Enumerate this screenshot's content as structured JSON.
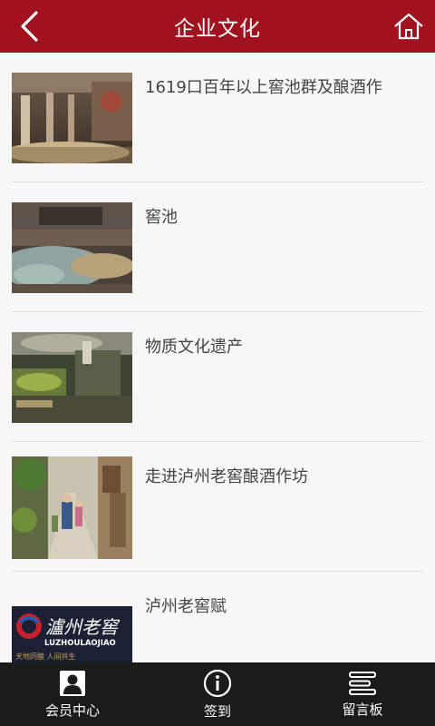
{
  "header": {
    "title": "企业文化",
    "back_icon": "chevron-left-icon",
    "home_icon": "home-icon"
  },
  "colors": {
    "brand": "#a2121e",
    "tabbar": "#1b1b1b"
  },
  "articles": [
    {
      "title": "1619口百年以上窖池群及酿酒作",
      "image": "cellar-pits-photo"
    },
    {
      "title": "窖池",
      "image": "cellar-pit-photo"
    },
    {
      "title": "物质文化遗产",
      "image": "distillery-equipment-photo"
    },
    {
      "title": "走进泸州老窖酿酒作坊",
      "image": "alley-street-photo"
    },
    {
      "title": "泸州老窖赋",
      "image": "luzhou-laojiao-logo",
      "logo_text": "瀘州老窖",
      "logo_en": "LUZHOULAOJIAO",
      "logo_sub": "天地同酿   人间共生"
    }
  ],
  "tabs": [
    {
      "label": "会员中心",
      "icon": "user-icon"
    },
    {
      "label": "签到",
      "icon": "info-icon"
    },
    {
      "label": "留言板",
      "icon": "message-board-icon"
    }
  ]
}
